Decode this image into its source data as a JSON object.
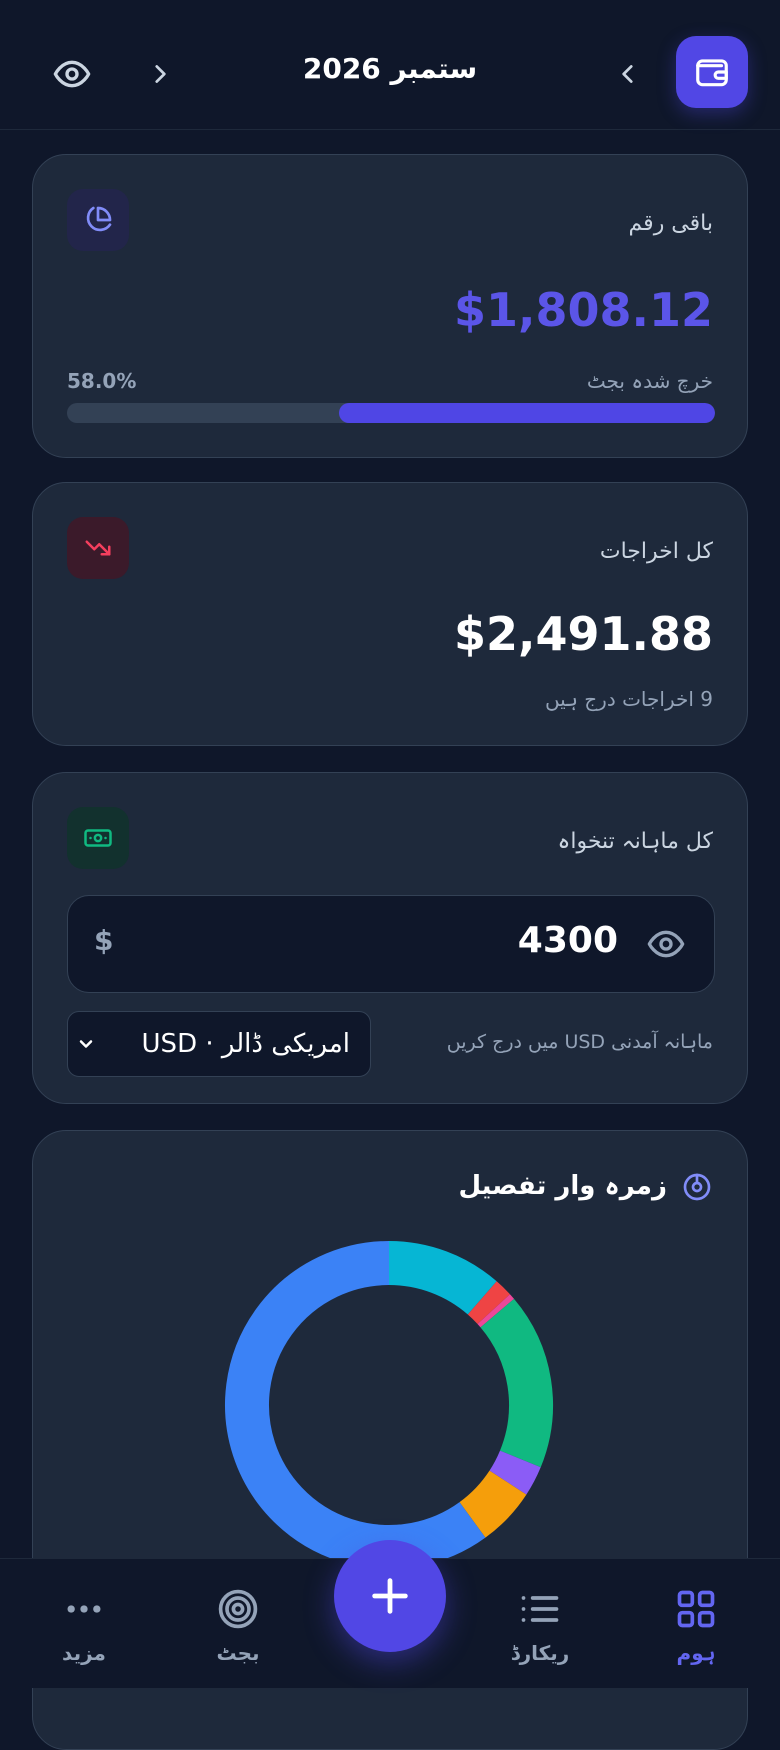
{
  "header": {
    "month_label": "ستمبر 2026",
    "eye_icon": "eye-icon",
    "next_icon": "chevron-right-icon",
    "prev_icon": "chevron-left-icon",
    "logo_icon": "wallet-icon",
    "accent": "#5147e5"
  },
  "remaining": {
    "title": "باقی رقم",
    "amount": "$1,808.12",
    "spent_label": "خرچ شدہ بجٹ",
    "spent_percent_text": "58.0%",
    "spent_fraction": 0.58,
    "icon": "pie-chart-icon"
  },
  "expenses": {
    "title": "کل اخراجات",
    "amount": "$2,491.88",
    "count_text": "9 اخراجات درج ہیں",
    "icon": "trending-down-icon"
  },
  "salary": {
    "title": "کل ماہانہ تنخواہ",
    "currency_symbol": "$",
    "value": "4300",
    "hint": "ماہانہ آمدنی USD میں درج کریں",
    "currency_select": "USD · امریکی ڈالر",
    "icon": "banknote-icon"
  },
  "breakdown": {
    "title": "زمرہ وار تفصیل",
    "icon": "donut-chart-icon"
  },
  "chart_data": {
    "type": "pie",
    "title": "",
    "series": [
      {
        "value": 0.114,
        "color": "#06b6d4"
      },
      {
        "value": 0.018,
        "color": "#ef4444"
      },
      {
        "value": 0.006,
        "color": "#ec4899"
      },
      {
        "value": 0.174,
        "color": "#10b981"
      },
      {
        "value": 0.03,
        "color": "#8b5cf6"
      },
      {
        "value": 0.058,
        "color": "#f59e0b"
      },
      {
        "value": 0.6,
        "color": "#3b82f6"
      }
    ]
  },
  "nav": {
    "items": [
      {
        "label": "ہوم",
        "icon": "grid-icon",
        "active": true
      },
      {
        "label": "ریکارڈ",
        "icon": "list-icon",
        "active": false
      },
      {
        "label": "بجٹ",
        "icon": "target-icon",
        "active": false
      },
      {
        "label": "مزید",
        "icon": "more-icon",
        "active": false
      }
    ],
    "fab_icon": "plus-icon"
  }
}
